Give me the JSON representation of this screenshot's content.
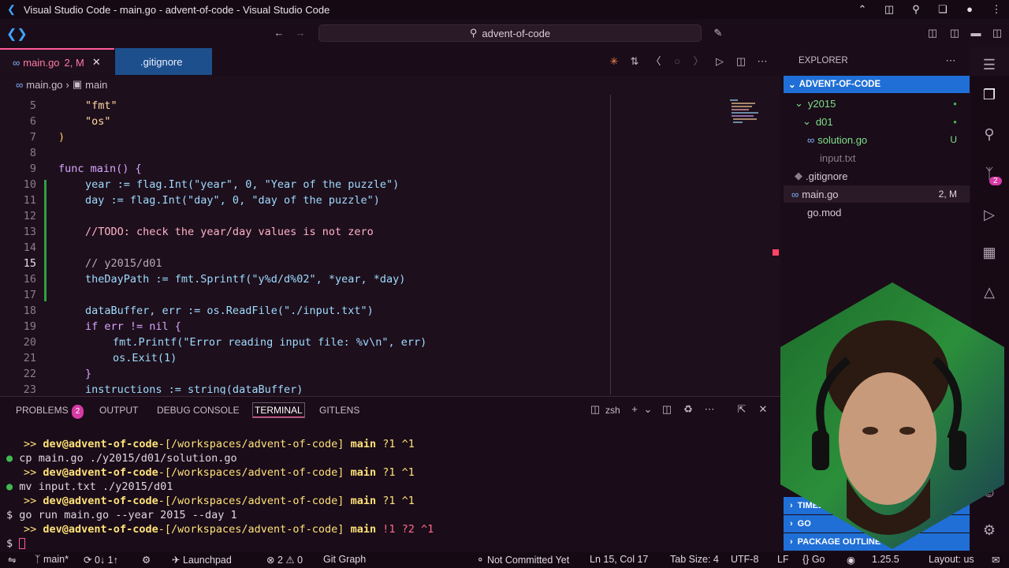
{
  "window": {
    "title": "Visual Studio Code - main.go - advent-of-code - Visual Studio Code"
  },
  "search": {
    "text": "advent-of-code"
  },
  "tabs": [
    {
      "label": "main.go",
      "status": "2, M"
    },
    {
      "label": ".gitignore"
    }
  ],
  "breadcrumb": {
    "file": "main.go",
    "symbol": "main"
  },
  "editor": {
    "lines": [
      {
        "n": "5",
        "text": "\"fmt\""
      },
      {
        "n": "6",
        "text": "\"os\""
      },
      {
        "n": "7",
        "text": ")"
      },
      {
        "n": "8",
        "text": ""
      },
      {
        "n": "9",
        "text": "func main() {"
      },
      {
        "n": "10",
        "text": "year := flag.Int(\"year\", 0, \"Year of the puzzle\")"
      },
      {
        "n": "11",
        "text": "day := flag.Int(\"day\", 0, \"day of the puzzle\")"
      },
      {
        "n": "12",
        "text": ""
      },
      {
        "n": "13",
        "text": "//TODO: check the year/day values is not zero"
      },
      {
        "n": "14",
        "text": ""
      },
      {
        "n": "15",
        "text": "// y2015/d01"
      },
      {
        "n": "16",
        "text": "theDayPath := fmt.Sprintf(\"y%d/d%02\", *year, *day)"
      },
      {
        "n": "17",
        "text": ""
      },
      {
        "n": "18",
        "text": "dataBuffer, err := os.ReadFile(\"./input.txt\")"
      },
      {
        "n": "19",
        "text": "if err != nil {"
      },
      {
        "n": "20",
        "text": "fmt.Printf(\"Error reading input file: %v\\n\", err)"
      },
      {
        "n": "21",
        "text": "os.Exit(1)"
      },
      {
        "n": "22",
        "text": "}"
      },
      {
        "n": "23",
        "text": "instructions := string(dataBuffer)"
      }
    ]
  },
  "panel": {
    "tabs": {
      "problems": "PROBLEMS",
      "problems_count": "2",
      "output": "OUTPUT",
      "debug": "DEBUG CONSOLE",
      "terminal": "TERMINAL",
      "gitlens": "GITLENS"
    },
    "shell": "zsh",
    "terminal": [
      {
        "prompt": ">>",
        "user": "dev@advent-of-code",
        "path": "-[/workspaces/advent-of-code]",
        "branch": "main",
        "stat": "?1 ^1"
      },
      {
        "cmd": "cp",
        "args": "main.go ./y2015/d01/solution.go"
      },
      {
        "prompt": ">>",
        "user": "dev@advent-of-code",
        "path": "-[/workspaces/advent-of-code]",
        "branch": "main",
        "stat": "?1 ^1"
      },
      {
        "cmd": "mv",
        "args": "input.txt ./y2015/d01"
      },
      {
        "prompt": ">>",
        "user": "dev@advent-of-code",
        "path": "-[/workspaces/advent-of-code]",
        "branch": "main",
        "stat": "?1 ^1"
      },
      {
        "cmd": "go run",
        "args": "main.go --year 2015 --day 1"
      },
      {
        "prompt": ">>",
        "user": "dev@advent-of-code",
        "path": "-[/workspaces/advent-of-code]",
        "branch": "main",
        "stat": "!1 ?2 ^1"
      },
      {
        "cmd": "$",
        "args": ""
      }
    ]
  },
  "explorer": {
    "title": "EXPLORER",
    "root": "ADVENT-OF-CODE",
    "items": [
      {
        "label": "y2015",
        "status": ""
      },
      {
        "label": "d01",
        "status": ""
      },
      {
        "label": "solution.go",
        "status": "U"
      },
      {
        "label": "input.txt",
        "status": ""
      },
      {
        "label": ".gitignore",
        "status": ""
      },
      {
        "label": "main.go",
        "status": "2, M"
      },
      {
        "label": "go.mod",
        "status": ""
      }
    ],
    "sections": [
      "TIMELINE",
      "GO",
      "PACKAGE OUTLINE"
    ]
  },
  "activity": {
    "scm_badge": "2"
  },
  "statusbar": {
    "branch": "main*",
    "sync": "0↓ 1↑",
    "launchpad": "Launchpad",
    "errors": "2",
    "warnings": "0",
    "git_graph": "Git Graph",
    "blame": "Not Committed Yet",
    "position": "Ln 15, Col 17",
    "tab_size": "Tab Size: 4",
    "encoding": "UTF-8",
    "eol": "LF",
    "language": "Go",
    "go_version": "1.25.5",
    "layout": "Layout: us"
  },
  "colors": {
    "accent": "#ff5a9a",
    "selection": "#1f6fd6",
    "background": "#1e0f1c"
  }
}
